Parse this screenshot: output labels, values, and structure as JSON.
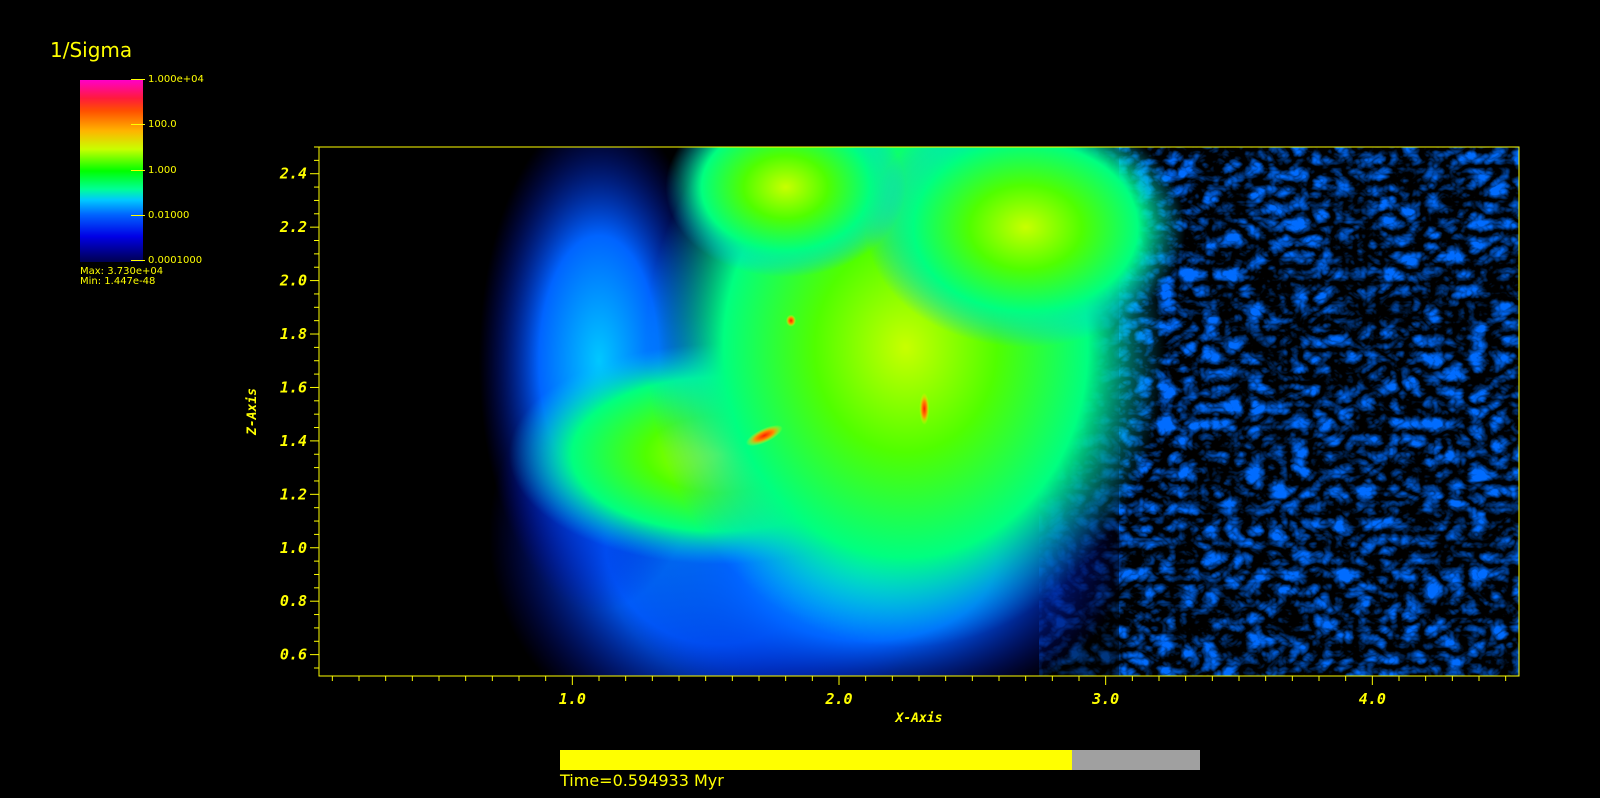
{
  "legend": {
    "title": "1/Sigma",
    "ticks": [
      "1.000e+04",
      "100.0",
      "1.000",
      "0.01000",
      "0.0001000"
    ],
    "max_label": "Max:  3.730e+04",
    "min_label": "Min:  1.447e-48"
  },
  "colors": {
    "text": "#ffff00",
    "background": "#000000",
    "progress_track": "#a0a0a0"
  },
  "time": {
    "label": "Time=0.594933 Myr",
    "progress_fraction": 0.8
  },
  "chart_data": {
    "type": "heatmap",
    "title": "",
    "xlabel": "X-Axis",
    "ylabel": "Z-Axis",
    "xlim": [
      0.05,
      4.55
    ],
    "ylim": [
      0.52,
      2.5
    ],
    "x_ticks": [
      "1.0",
      "2.0",
      "3.0",
      "4.0"
    ],
    "y_ticks": [
      "0.6",
      "0.8",
      "1.0",
      "1.2",
      "1.4",
      "1.6",
      "1.8",
      "2.0",
      "2.2",
      "2.4"
    ],
    "color_scale": "log",
    "color_range": [
      0.0001,
      10000
    ],
    "grid": false
  }
}
